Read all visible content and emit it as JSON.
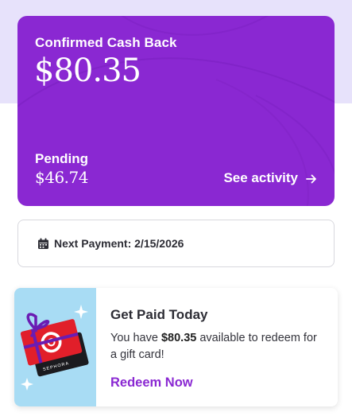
{
  "cash_card": {
    "label": "Confirmed Cash Back",
    "amount": "$80.35",
    "pending_label": "Pending",
    "pending_amount": "$46.74",
    "see_activity": "See activity"
  },
  "payment": {
    "text": "Next Payment: 2/15/2026"
  },
  "gift_promo": {
    "title": "Get Paid Today",
    "desc_prefix": "You have ",
    "desc_amount": "$80.35",
    "desc_suffix": " available to redeem for a gift card!",
    "cta": "Redeem Now",
    "card_brand": "SEPHORA"
  },
  "colors": {
    "brand_purple": "#8a28d2",
    "top_band": "#e7e2fb",
    "gift_bg": "#a8dcf4"
  },
  "icons": {
    "arrow": "arrow-right-icon",
    "calendar": "calendar-icon",
    "sparkle": "sparkle-icon"
  }
}
